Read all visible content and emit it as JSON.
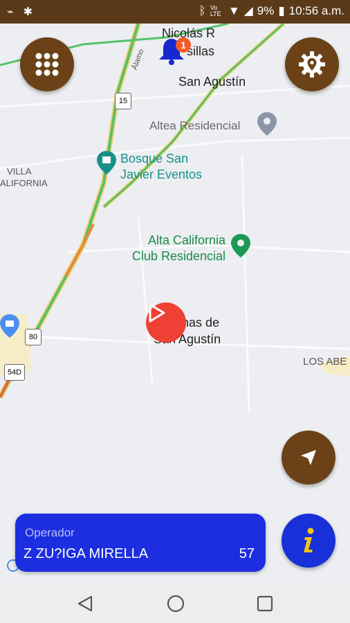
{
  "status_bar": {
    "battery": "9%",
    "time": "10:56 a.m.",
    "network": "Vo LTE"
  },
  "map": {
    "labels": {
      "nicolas": "Nicolás R",
      "casillas": "sillas",
      "san_agustin": "San Agustín",
      "altea": "Altea Residencial",
      "bosque_1": "Bosque San",
      "bosque_2": "Javier Eventos",
      "villa_1": "VILLA",
      "villa_2": "ALIFORNIA",
      "alta_1": "Alta California",
      "alta_2": "Club Residencial",
      "lomas_1": "mas de",
      "lomas_2": "San Agustín",
      "los_abe": "LOS ABE",
      "alamo": "Álamo",
      "hw_15": "15",
      "hw_80": "80",
      "hw_54d": "54D"
    }
  },
  "notifications": {
    "count": "1"
  },
  "operator": {
    "label": "Operador",
    "name": "Z ZU?IGA MIRELLA",
    "number": "57"
  },
  "colors": {
    "brown": "#6b4218",
    "blue": "#1c2ee0",
    "status_bar": "#5b3a1a",
    "marker_red": "#ee4035",
    "info_yellow": "#f5c60f"
  },
  "icons": {
    "menu": "grid-icon",
    "settings": "gear-location-icon",
    "notifications": "bell-icon",
    "locate": "navigation-arrow-icon",
    "info": "info-icon",
    "marker": "vehicle-marker-icon"
  }
}
